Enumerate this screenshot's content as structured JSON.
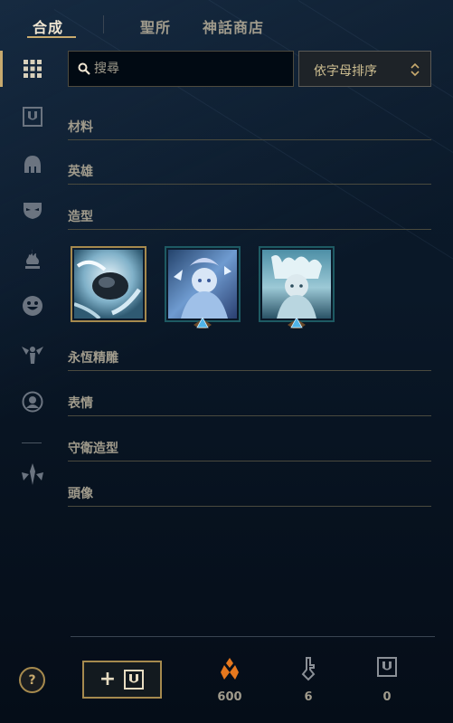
{
  "tabs": [
    {
      "label": "合成",
      "active": true
    },
    {
      "label": "聖所",
      "active": false
    },
    {
      "label": "神話商店",
      "active": false
    }
  ],
  "sidebar": {
    "items": [
      {
        "icon": "grid-icon",
        "active": true
      },
      {
        "icon": "shield-crest-icon",
        "active": false
      },
      {
        "icon": "helmet-icon",
        "active": false
      },
      {
        "icon": "mask-icon",
        "active": false
      },
      {
        "icon": "flame-icon",
        "active": false
      },
      {
        "icon": "smiley-icon",
        "active": false
      },
      {
        "icon": "ward-totem-icon",
        "active": false
      },
      {
        "icon": "profile-circle-icon",
        "active": false
      },
      {
        "icon": "mythic-spire-icon",
        "active": false
      }
    ]
  },
  "search": {
    "placeholder": "搜尋",
    "value": ""
  },
  "sort": {
    "label": "依字母排序"
  },
  "sections": {
    "materials": "材料",
    "champions": "英雄",
    "skins": "造型",
    "eternals": "永恆精雕",
    "emotes": "表情",
    "ward_skins": "守衛造型",
    "icons": "頭像"
  },
  "skin_tiles": [
    {
      "name": "owned-skin-tile",
      "owned": true,
      "gem": false
    },
    {
      "name": "shard-skin-tile-2",
      "owned": false,
      "gem": true
    },
    {
      "name": "shard-skin-tile-3",
      "owned": false,
      "gem": true
    }
  ],
  "footer": {
    "help_label": "?",
    "craft_plus": "+",
    "currencies": [
      {
        "icon": "orange-essence-icon",
        "value": "600",
        "color": "#e6781e"
      },
      {
        "icon": "key-fragment-icon",
        "value": "6",
        "color": "#a09b8c"
      },
      {
        "icon": "chest-crest-icon",
        "value": "0",
        "color": "#a09b8c"
      }
    ]
  },
  "colors": {
    "accent": "#c8aa6e",
    "text": "#a09b8c",
    "bg": "#0a1828"
  }
}
